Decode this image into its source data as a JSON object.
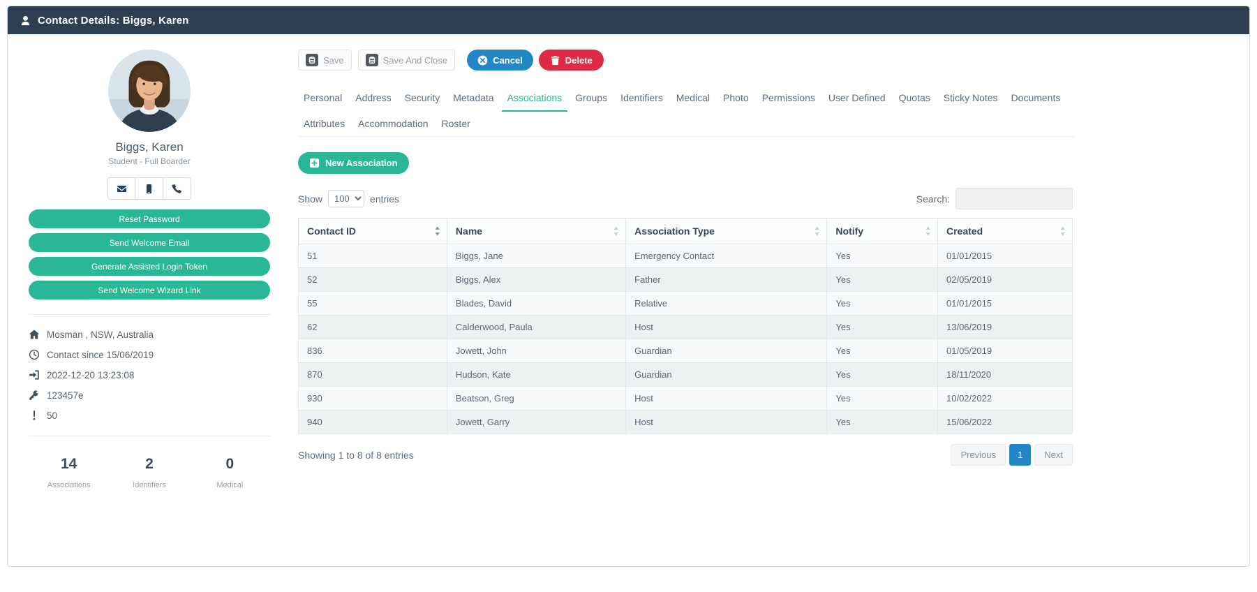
{
  "colors": {
    "navy": "#2d4053",
    "teal": "#2ab795",
    "blue": "#2386c6",
    "red": "#df2a44"
  },
  "header": {
    "title": "Contact Details: Biggs, Karen"
  },
  "sidebar": {
    "name": "Biggs, Karen",
    "role": "Student - Full Boarder",
    "contact_methods": [
      "email",
      "mobile",
      "phone"
    ],
    "action_buttons": [
      "Reset Password",
      "Send Welcome Email",
      "Generate Assisted Login Token",
      "Send Welcome Wizard Link"
    ],
    "info_items": [
      {
        "icon": "home",
        "text": "Mosman , NSW, Australia"
      },
      {
        "icon": "clock",
        "text": "Contact since 15/06/2019"
      },
      {
        "icon": "sign-in",
        "text": "2022-12-20 13:23:08"
      },
      {
        "icon": "key",
        "text": "123457e"
      },
      {
        "icon": "exclamation",
        "text": "50"
      }
    ],
    "stats": [
      {
        "value": "14",
        "label": "Associations"
      },
      {
        "value": "2",
        "label": "Identifiers"
      },
      {
        "value": "0",
        "label": "Medical"
      }
    ]
  },
  "toolbar": {
    "save": "Save",
    "save_and_close": "Save And Close",
    "cancel": "Cancel",
    "delete": "Delete"
  },
  "tabs": {
    "active": "Associations",
    "items": [
      "Personal",
      "Address",
      "Security",
      "Metadata",
      "Associations",
      "Groups",
      "Identifiers",
      "Medical",
      "Photo",
      "Permissions",
      "User Defined",
      "Quotas",
      "Sticky Notes",
      "Documents",
      "Attributes",
      "Accommodation",
      "Roster"
    ]
  },
  "associations": {
    "new_button": "New Association",
    "show_label": "Show",
    "page_size": "100",
    "entries_label": "entries",
    "search_label": "Search:",
    "table": {
      "sorted_column": "Contact ID",
      "columns": [
        "Contact ID",
        "Name",
        "Association Type",
        "Notify",
        "Created"
      ],
      "rows": [
        [
          "51",
          "Biggs, Jane",
          "Emergency Contact",
          "Yes",
          "01/01/2015"
        ],
        [
          "52",
          "Biggs, Alex",
          "Father",
          "Yes",
          "02/05/2019"
        ],
        [
          "55",
          "Blades, David",
          "Relative",
          "Yes",
          "01/01/2015"
        ],
        [
          "62",
          "Calderwood, Paula",
          "Host",
          "Yes",
          "13/06/2019"
        ],
        [
          "836",
          "Jowett, John",
          "Guardian",
          "Yes",
          "01/05/2019"
        ],
        [
          "870",
          "Hudson, Kate",
          "Guardian",
          "Yes",
          "18/11/2020"
        ],
        [
          "930",
          "Beatson, Greg",
          "Host",
          "Yes",
          "10/02/2022"
        ],
        [
          "940",
          "Jowett, Garry",
          "Host",
          "Yes",
          "15/06/2022"
        ]
      ]
    },
    "summary": "Showing 1 to 8 of 8 entries",
    "pagination": {
      "previous": "Previous",
      "current": "1",
      "next": "Next"
    }
  }
}
